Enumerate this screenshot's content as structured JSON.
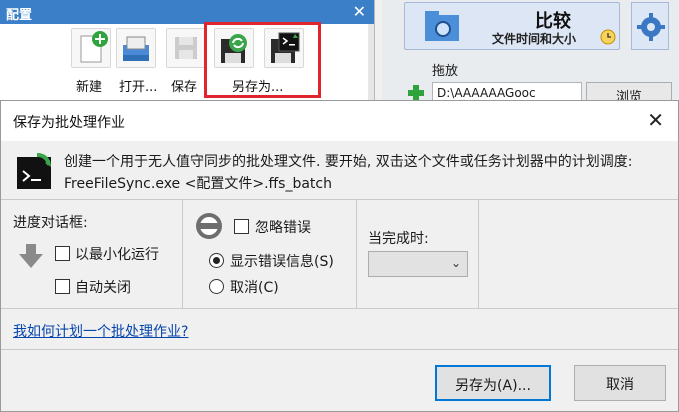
{
  "config_panel": {
    "title": "配置",
    "toolbar": [
      {
        "label": "新建"
      },
      {
        "label": "打开..."
      },
      {
        "label": "保存"
      },
      {
        "label": "另存为..."
      }
    ]
  },
  "compare": {
    "main": "比较",
    "sub": "文件时间和大小"
  },
  "folder": {
    "drop_label": "拖放",
    "path": "D:\\AAAAAAGooc",
    "browse": "浏览"
  },
  "dialog": {
    "title": "保存为批处理作业",
    "info_line1": "创建一个用于无人值守同步的批处理文件. 要开始, 双击这个文件或任务计划器中的计划调度:",
    "info_line2": "FreeFileSync.exe <配置文件>.ffs_batch",
    "progress_group": "进度对话框:",
    "run_minimized": "以最小化运行",
    "auto_close": "自动关闭",
    "ignore_errors": "忽略错误",
    "show_errors": "显示错误信息(S)",
    "cancel_option": "取消(C)",
    "on_completion": "当完成时:",
    "on_completion_value": "",
    "howto_link": "我如何计划一个批处理作业?",
    "save_as_button": "另存为(A)...",
    "cancel_button": "取消"
  },
  "colors": {
    "accent": "#0078d7",
    "highlight": "#e0252c",
    "title_bar": "#3a7fc8",
    "link": "#0645ad"
  }
}
